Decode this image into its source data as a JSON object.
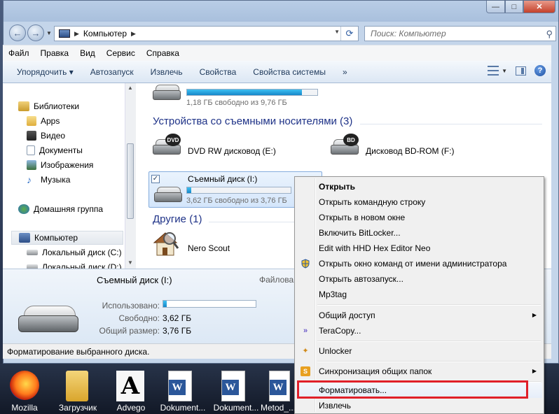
{
  "window": {
    "address_segment": "Компьютер",
    "search_placeholder": "Поиск: Компьютер"
  },
  "menubar": [
    "Файл",
    "Правка",
    "Вид",
    "Сервис",
    "Справка"
  ],
  "commands": [
    "Упорядочить ▾",
    "Автозапуск",
    "Извлечь",
    "Свойства",
    "Свойства системы",
    "»"
  ],
  "nav": {
    "libraries": "Библиотеки",
    "apps": "Apps",
    "video": "Видео",
    "documents": "Документы",
    "images": "Изображения",
    "music": "Музыка",
    "homegroup": "Домашняя группа",
    "computer": "Компьютер",
    "local_c": "Локальный диск (C:)",
    "local_d": "Локальный диск (D:)"
  },
  "content": {
    "top_drive_sub": "1,18 ГБ свободно из 9,76 ГБ",
    "top_drive_fill": 0.88,
    "group_removable": "Устройства со съемными носителями (3)",
    "dvd_name": "DVD RW дисковод (E:)",
    "bd_name": "Дисковод BD-ROM (F:)",
    "removable_name": "Съемный диск (I:)",
    "removable_sub": "3,62 ГБ свободно из 3,76 ГБ",
    "removable_fill": 0.04,
    "group_other": "Другие (1)",
    "nero_name": "Nero Scout"
  },
  "details": {
    "title": "Съемный диск (I:)",
    "fs_label": "Файлова",
    "used_label": "Использовано:",
    "free_label": "Свободно:",
    "free_value": "3,62 ГБ",
    "total_label": "Общий размер:",
    "total_value": "3,76 ГБ",
    "used_fill": 0.04
  },
  "status": "Форматирование выбранного диска.",
  "context_menu": {
    "open": "Открыть",
    "open_cmd": "Открыть командную строку",
    "open_new": "Открыть в новом окне",
    "bitlocker": "Включить BitLocker...",
    "hhd": "Edit with HHD Hex Editor Neo",
    "admin_cmd": "Открыть окно команд от имени администратора",
    "autorun": "Открыть автозапуск...",
    "mp3tag": "Mp3tag",
    "share": "Общий доступ",
    "teracopy": "TeraCopy...",
    "unlocker": "Unlocker",
    "sync": "Синхронизация общих папок",
    "format": "Форматировать...",
    "eject": "Извлечь"
  },
  "taskbar": [
    "Mozilla",
    "Загрузчик",
    "Advego",
    "Dokument...",
    "Dokument...",
    "Metod_..."
  ],
  "colors": {
    "highlight_border": "#e0202a",
    "group_header": "#1e3287"
  }
}
